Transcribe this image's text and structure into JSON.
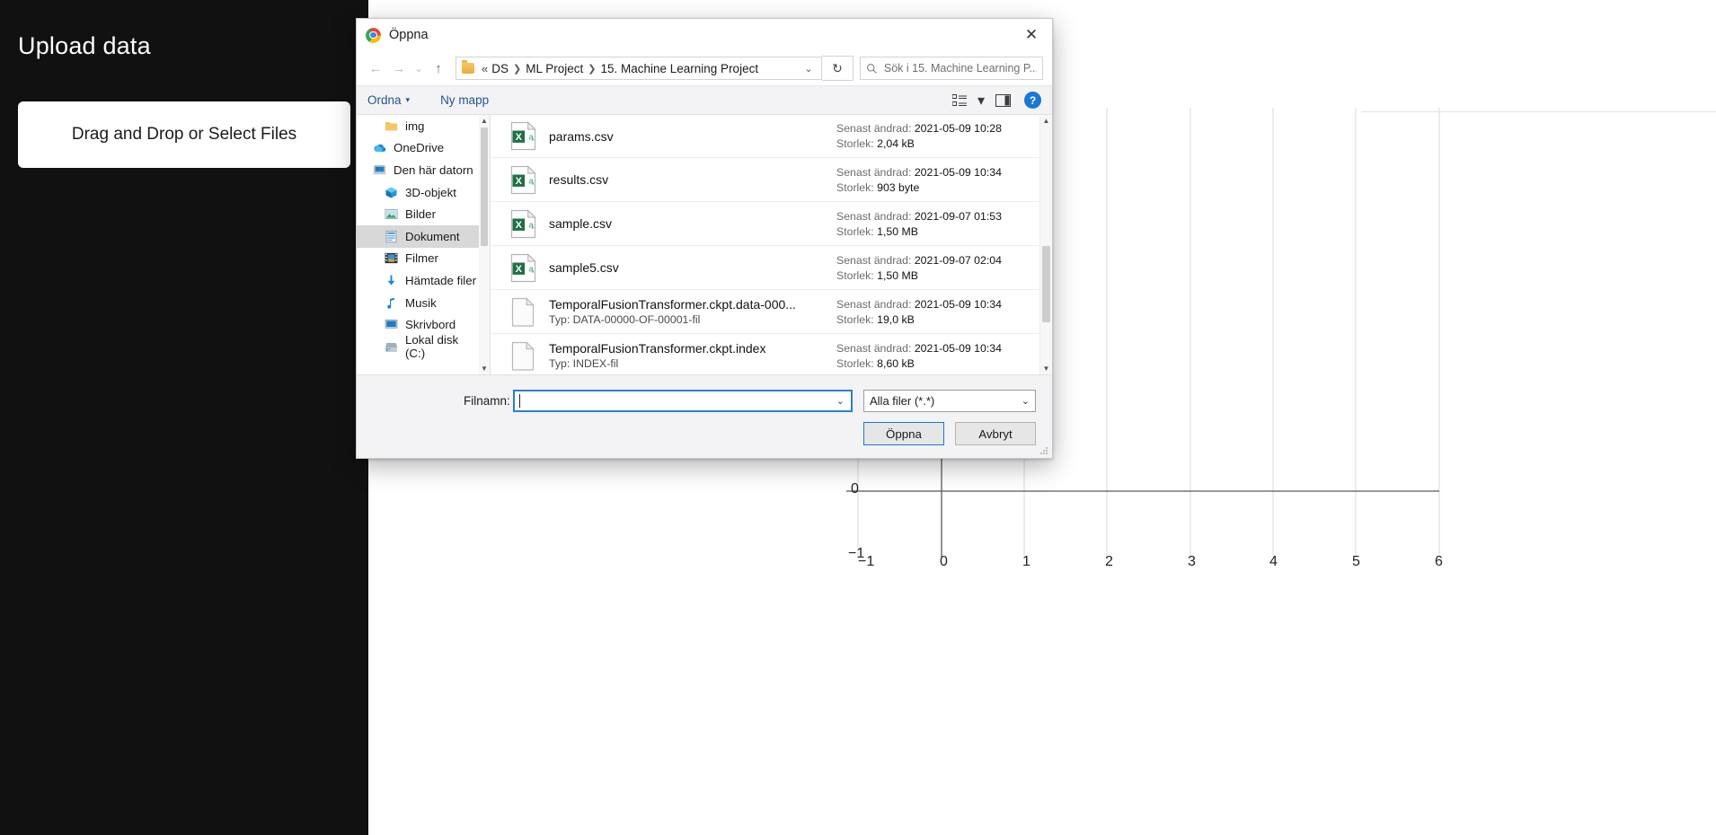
{
  "app": {
    "title": "Upload data",
    "dropzone_label": "Drag and Drop or Select Files"
  },
  "chart_data": {
    "type": "line",
    "title": "",
    "xlabel": "",
    "ylabel": "",
    "xlim": [
      -1,
      6
    ],
    "ylim": [
      -1,
      1
    ],
    "xticks": [
      "−1",
      "0",
      "1",
      "2",
      "3",
      "4",
      "5",
      "6"
    ],
    "yticks": [
      "0"
    ],
    "grid": true,
    "series": [],
    "notes": "Empty axes; only y tick 0 visible, x ticks -1..6"
  },
  "dialog": {
    "title": "Öppna",
    "app_icon": "chrome-logo-icon",
    "close_label": "✕",
    "nav": {
      "back": "←",
      "forward": "→",
      "recent": "⌄",
      "up": "↑",
      "refresh": "↻",
      "breadcrumb_sep": "«",
      "breadcrumb": [
        "DS",
        "ML Project",
        "15. Machine Learning Project"
      ],
      "breadcrumb_caret": "⌄"
    },
    "search": {
      "icon": "search-icon",
      "placeholder": "Sök i 15. Machine Learning P..."
    },
    "commandbar": {
      "organize_label": "Ordna",
      "organize_caret": "▾",
      "new_folder_label": "Ny mapp",
      "view_icon": "view-list-icon",
      "view_caret": "▾",
      "preview_icon": "preview-pane-icon",
      "help_label": "?"
    },
    "tree": [
      {
        "label": "img",
        "icon": "folder-icon",
        "indent": 2,
        "selected": false
      },
      {
        "label": "OneDrive",
        "icon": "onedrive-icon",
        "indent": 1,
        "selected": false
      },
      {
        "label": "Den här datorn",
        "icon": "this-pc-icon",
        "indent": 1,
        "selected": false
      },
      {
        "label": "3D-objekt",
        "icon": "3d-objects-icon",
        "indent": 2,
        "selected": false
      },
      {
        "label": "Bilder",
        "icon": "pictures-icon",
        "indent": 2,
        "selected": false
      },
      {
        "label": "Dokument",
        "icon": "documents-icon",
        "indent": 2,
        "selected": true
      },
      {
        "label": "Filmer",
        "icon": "videos-icon",
        "indent": 2,
        "selected": false
      },
      {
        "label": "Hämtade filer",
        "icon": "downloads-icon",
        "indent": 2,
        "selected": false
      },
      {
        "label": "Musik",
        "icon": "music-icon",
        "indent": 2,
        "selected": false
      },
      {
        "label": "Skrivbord",
        "icon": "desktop-icon",
        "indent": 2,
        "selected": false
      },
      {
        "label": "Lokal disk (C:)",
        "icon": "drive-icon",
        "indent": 2,
        "selected": false
      }
    ],
    "files": [
      {
        "name": "params.csv",
        "type": "",
        "icon": "excel-csv-icon",
        "modified_key": "Senast ändrad:",
        "modified_value": "2021-05-09 10:28",
        "size_key": "Storlek:",
        "size_value": "2,04 kB"
      },
      {
        "name": "results.csv",
        "type": "",
        "icon": "excel-csv-icon",
        "modified_key": "Senast ändrad:",
        "modified_value": "2021-05-09 10:34",
        "size_key": "Storlek:",
        "size_value": "903 byte"
      },
      {
        "name": "sample.csv",
        "type": "",
        "icon": "excel-csv-icon",
        "modified_key": "Senast ändrad:",
        "modified_value": "2021-09-07 01:53",
        "size_key": "Storlek:",
        "size_value": "1,50 MB"
      },
      {
        "name": "sample5.csv",
        "type": "",
        "icon": "excel-csv-icon",
        "modified_key": "Senast ändrad:",
        "modified_value": "2021-09-07 02:04",
        "size_key": "Storlek:",
        "size_value": "1,50 MB"
      },
      {
        "name": "TemporalFusionTransformer.ckpt.data-000...",
        "type": "Typ: DATA-00000-OF-00001-fil",
        "icon": "generic-file-icon",
        "modified_key": "Senast ändrad:",
        "modified_value": "2021-05-09 10:34",
        "size_key": "Storlek:",
        "size_value": "19,0 kB"
      },
      {
        "name": "TemporalFusionTransformer.ckpt.index",
        "type": "Typ: INDEX-fil",
        "icon": "generic-file-icon",
        "modified_key": "Senast ändrad:",
        "modified_value": "2021-05-09 10:34",
        "size_key": "Storlek:",
        "size_value": "8,60 kB"
      }
    ],
    "footer": {
      "filename_label": "Filnamn:",
      "filename_value": "",
      "filename_caret": "⌄",
      "filter_value": "Alla filer (*.*)",
      "filter_caret": "⌄",
      "open_label": "Öppna",
      "cancel_label": "Avbryt"
    }
  },
  "colors": {
    "accent_blue": "#1878d2",
    "focus_border": "#2a7fc9",
    "link_blue": "#26538c",
    "excel_green": "#1e7145",
    "sidebar_dark": "#111111",
    "chrome_blue": "#4285f4"
  }
}
